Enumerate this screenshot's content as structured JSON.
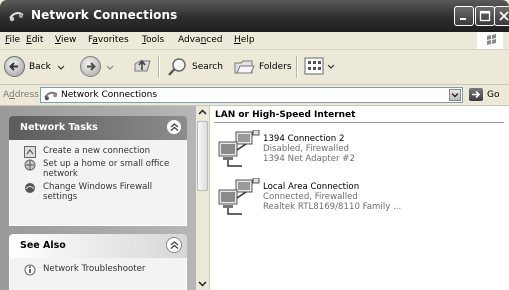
{
  "window": {
    "title": "Network Connections"
  },
  "menubar": {
    "items": [
      {
        "pre": "",
        "u": "F",
        "post": "ile"
      },
      {
        "pre": "",
        "u": "E",
        "post": "dit"
      },
      {
        "pre": "",
        "u": "V",
        "post": "iew"
      },
      {
        "pre": "F",
        "u": "a",
        "post": "vorites"
      },
      {
        "pre": "",
        "u": "T",
        "post": "ools"
      },
      {
        "pre": "Adva",
        "u": "n",
        "post": "ced"
      },
      {
        "pre": "",
        "u": "H",
        "post": "elp"
      }
    ]
  },
  "toolbar": {
    "back_label": "Back",
    "search_label": "Search",
    "folders_label": "Folders"
  },
  "address": {
    "label_pre": "A",
    "label_u": "d",
    "label_post": "dress",
    "value": "Network Connections",
    "go_label": "Go"
  },
  "tasks_panel": {
    "title": "Network Tasks",
    "items": [
      {
        "label": "Create a new connection",
        "icon": "new-connection-icon"
      },
      {
        "label": "Set up a home or small office network",
        "icon": "home-network-icon"
      },
      {
        "label": "Change Windows Firewall settings",
        "icon": "firewall-icon"
      }
    ]
  },
  "see_also_panel": {
    "title": "See Also",
    "items": [
      {
        "label": "Network Troubleshooter",
        "icon": "info-icon"
      }
    ]
  },
  "content": {
    "section_title": "LAN or High-Speed Internet",
    "connections": [
      {
        "name": "1394 Connection 2",
        "status": "Disabled, Firewalled",
        "device": "1394 Net Adapter #2"
      },
      {
        "name": "Local Area Connection",
        "status": "Connected, Firewalled",
        "device": "Realtek RTL8169/8110 Family ..."
      }
    ]
  }
}
